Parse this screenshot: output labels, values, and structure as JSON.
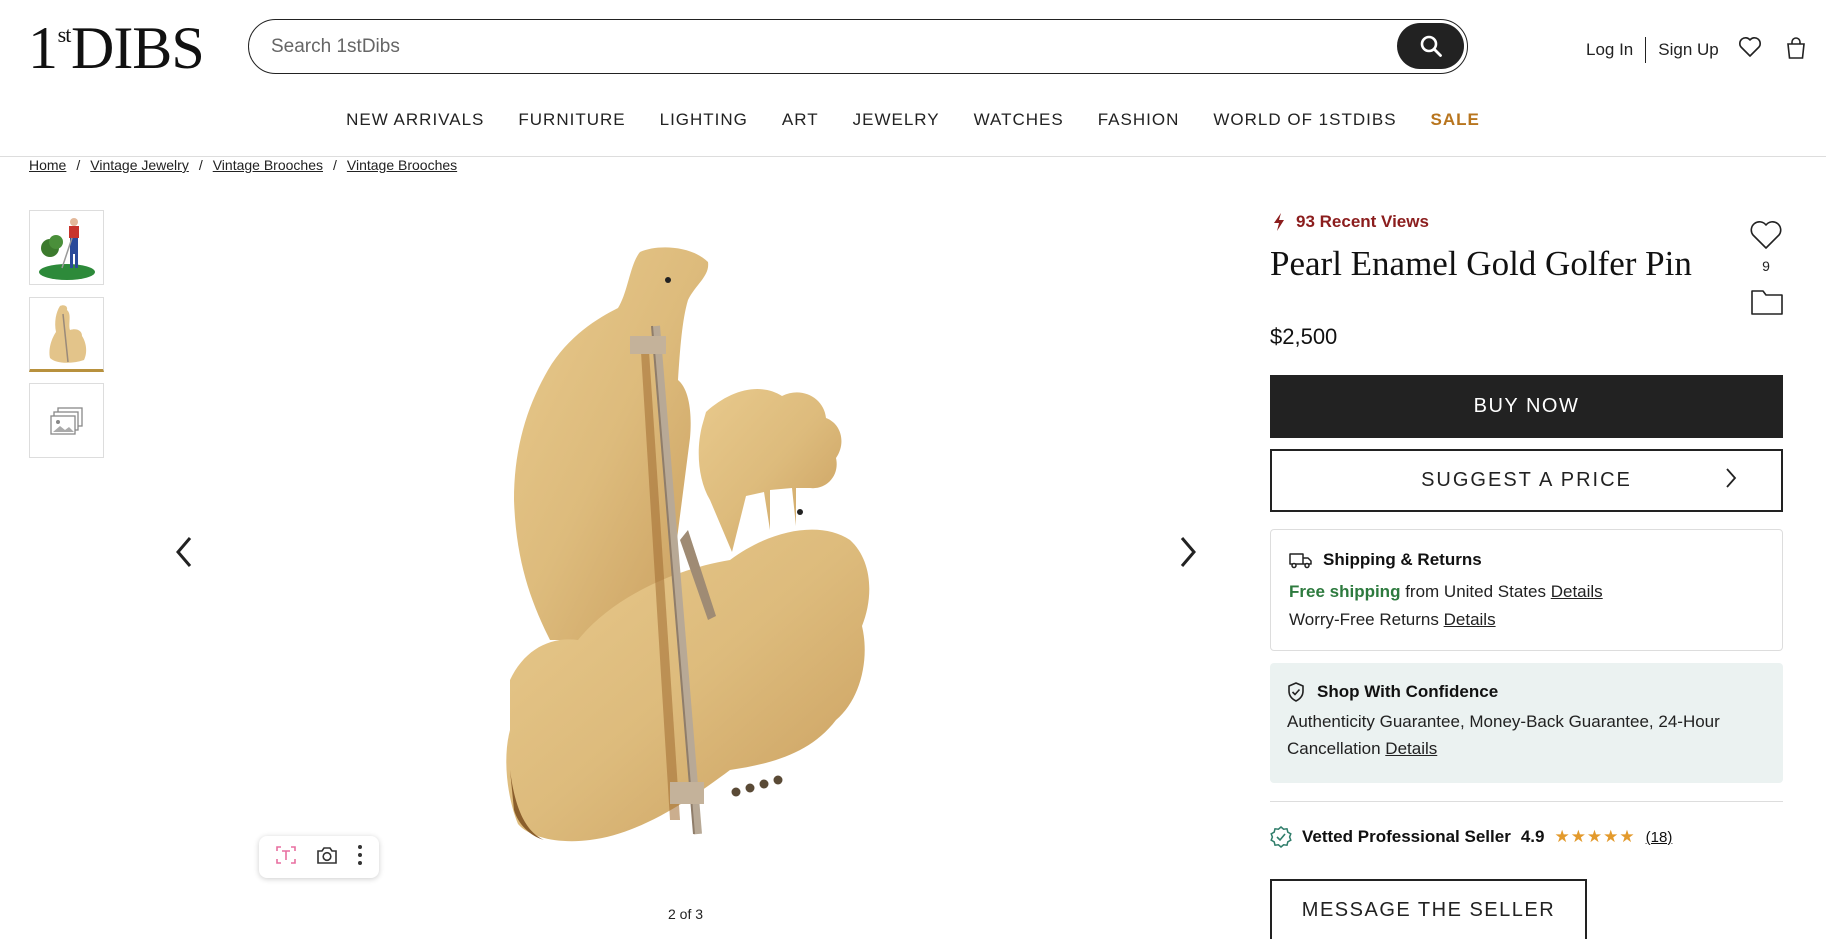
{
  "header": {
    "logo": {
      "pre": "1",
      "sup": "st",
      "post": "DIBS"
    },
    "search": {
      "placeholder": "Search 1stDibs",
      "value": ""
    },
    "login": "Log In",
    "signup": "Sign Up",
    "icons": [
      "heart-icon",
      "bag-icon",
      "search-icon"
    ]
  },
  "nav": {
    "items": [
      "NEW ARRIVALS",
      "FURNITURE",
      "LIGHTING",
      "ART",
      "JEWELRY",
      "WATCHES",
      "FASHION",
      "WORLD OF 1STDIBS"
    ],
    "sale": "SALE"
  },
  "breadcrumb": {
    "items": [
      "Home",
      "Vintage Jewelry",
      "Vintage Brooches",
      "Vintage Brooches"
    ],
    "separator": "/"
  },
  "gallery": {
    "counter": "2 of 3",
    "thumbnails": [
      "golfer-color-thumbnail",
      "golfer-back-thumbnail",
      "more-images-thumbnail"
    ],
    "active_index": 1
  },
  "product": {
    "recent_views": "93 Recent Views",
    "title": "Pearl Enamel Gold Golfer Pin",
    "favorites_count": "9",
    "price": "$2,500",
    "buy_label": "BUY NOW",
    "suggest_label": "SUGGEST A PRICE"
  },
  "shipping": {
    "heading": "Shipping & Returns",
    "free": "Free shipping",
    "from": "from United States",
    "details1": "Details",
    "returns": "Worry-Free Returns",
    "details2": "Details"
  },
  "confidence": {
    "heading": "Shop With Confidence",
    "text": "Authenticity Guarantee, Money-Back Guarantee, 24-Hour Cancellation",
    "details": "Details"
  },
  "seller": {
    "label": "Vetted Professional Seller",
    "rating": "4.9",
    "stars": "★★★★★",
    "reviews": "(18)",
    "message_label": "MESSAGE THE SELLER"
  },
  "colors": {
    "accent": "#b8751e",
    "views_red": "#8b1d1d",
    "free_green": "#2d7a3e",
    "star": "#e39a2c"
  }
}
